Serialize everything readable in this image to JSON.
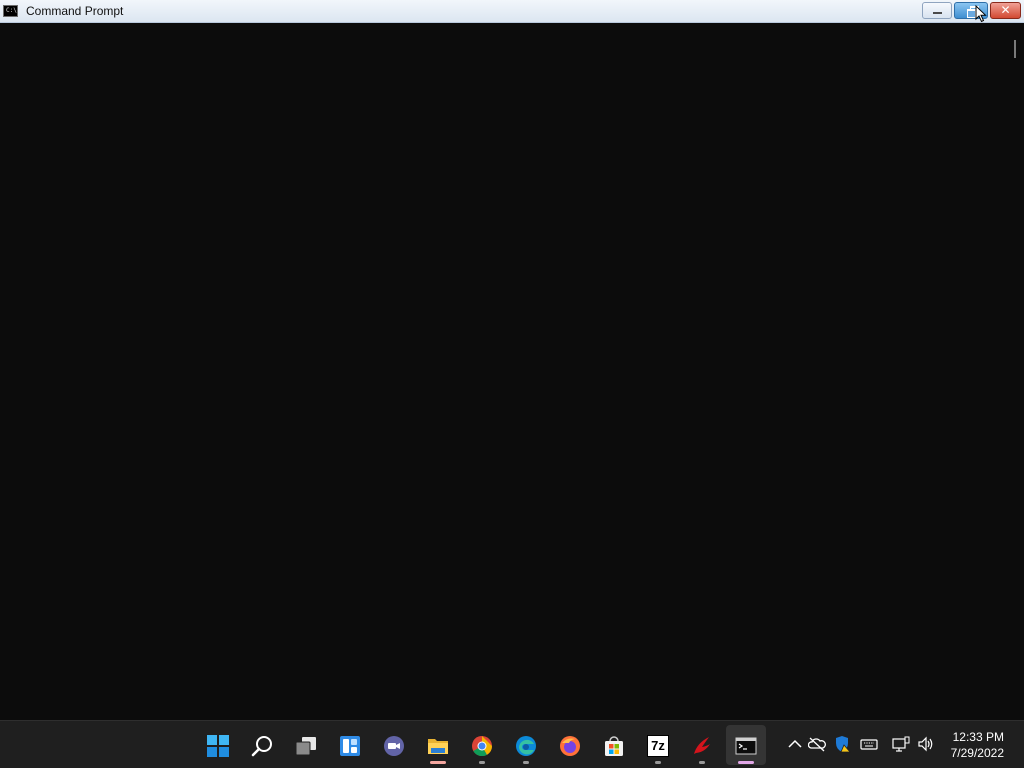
{
  "window": {
    "title": "Command Prompt",
    "icon_text": "C:\\"
  },
  "controls": {
    "minimize_icon": "minimize-icon",
    "maximize_icon": "restore-icon",
    "close_label": "✕"
  },
  "taskbar": {
    "apps": [
      {
        "name": "Start",
        "icon": "windows-logo-icon"
      },
      {
        "name": "Search",
        "icon": "search-icon"
      },
      {
        "name": "Task View",
        "icon": "task-view-icon"
      },
      {
        "name": "Widgets",
        "icon": "widgets-icon"
      },
      {
        "name": "Chat",
        "icon": "teams-chat-icon"
      },
      {
        "name": "File Explorer",
        "icon": "folder-icon"
      },
      {
        "name": "Google Chrome",
        "icon": "chrome-icon"
      },
      {
        "name": "Microsoft Edge",
        "icon": "edge-icon"
      },
      {
        "name": "Firefox",
        "icon": "firefox-icon"
      },
      {
        "name": "Microsoft Store",
        "icon": "store-icon"
      },
      {
        "name": "7-Zip",
        "icon": "7zip-icon",
        "label": "7z"
      },
      {
        "name": "Tcl/Tk",
        "icon": "tcl-feather-icon",
        "label": "Tk"
      },
      {
        "name": "Command Prompt",
        "icon": "terminal-icon"
      }
    ],
    "tray": {
      "chevron_icon": "chevron-up-icon",
      "onedrive_icon": "onedrive-cloud-icon",
      "security_icon": "security-warning-icon",
      "keyboard_icon": "keyboard-icon",
      "network_icon": "network-icon",
      "volume_icon": "volume-icon"
    },
    "clock": {
      "time": "12:33 PM",
      "date": "7/29/2022"
    }
  }
}
